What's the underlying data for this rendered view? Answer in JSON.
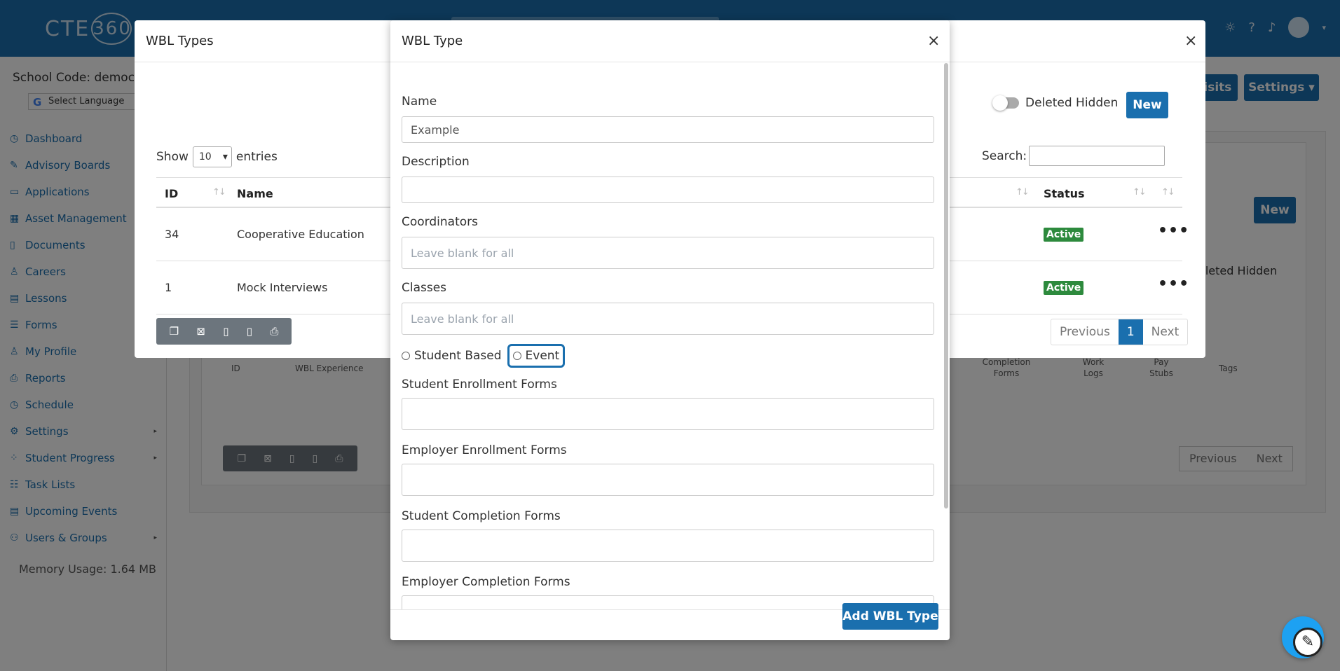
{
  "app": {
    "logo_text": "CTE",
    "logo_ring": "360",
    "school_code": "School Code: democt",
    "language_label": "Select Language",
    "memory": "Memory Usage: 1.64 MB",
    "nav": [
      {
        "label": "Dashboard",
        "icon": "dashboard-icon",
        "glyph": "◷",
        "arrow": false
      },
      {
        "label": "Advisory Boards",
        "icon": "advisory-boards-icon",
        "glyph": "✎",
        "arrow": false
      },
      {
        "label": "Applications",
        "icon": "applications-icon",
        "glyph": "▭",
        "arrow": false
      },
      {
        "label": "Asset Management",
        "icon": "asset-management-icon",
        "glyph": "▦",
        "arrow": false
      },
      {
        "label": "Documents",
        "icon": "documents-icon",
        "glyph": "▯",
        "arrow": false
      },
      {
        "label": "Careers",
        "icon": "careers-icon",
        "glyph": "♙",
        "arrow": false
      },
      {
        "label": "Lessons",
        "icon": "lessons-icon",
        "glyph": "▤",
        "arrow": false
      },
      {
        "label": "Forms",
        "icon": "forms-icon",
        "glyph": "☰",
        "arrow": false
      },
      {
        "label": "My Profile",
        "icon": "profile-icon",
        "glyph": "♙",
        "arrow": false
      },
      {
        "label": "Reports",
        "icon": "reports-icon",
        "glyph": "⎙",
        "arrow": false
      },
      {
        "label": "Schedule",
        "icon": "schedule-icon",
        "glyph": "◷",
        "arrow": false
      },
      {
        "label": "Settings",
        "icon": "settings-icon",
        "glyph": "⚙",
        "arrow": true
      },
      {
        "label": "Student Progress",
        "icon": "student-progress-icon",
        "glyph": "⁘",
        "arrow": true
      },
      {
        "label": "Task Lists",
        "icon": "task-lists-icon",
        "glyph": "☷",
        "arrow": false
      },
      {
        "label": "Upcoming Events",
        "icon": "upcoming-events-icon",
        "glyph": "▤",
        "arrow": false
      },
      {
        "label": "Users & Groups",
        "icon": "users-groups-icon",
        "glyph": "⚇",
        "arrow": true
      }
    ],
    "background": {
      "visits_btn": "Visits",
      "settings_btn": "Settings ▾",
      "new_btn": "New",
      "deleted_hidden": "eleted Hidden",
      "columns": [
        "ID",
        "WBL Experience",
        "Completion Forms",
        "Work Logs",
        "Pay Stubs",
        "Tags"
      ],
      "pager": [
        "Previous",
        "Next"
      ]
    }
  },
  "wbl_types_modal": {
    "title": "WBL Types",
    "deleted_label": "Deleted Hidden",
    "new_label": "New",
    "show_label": "Show",
    "show_value": "10",
    "entries_label": "entries",
    "search_label": "Search:",
    "columns": {
      "id": "ID",
      "name": "Name",
      "status": "Status"
    },
    "rows": [
      {
        "id": "34",
        "name": "Cooperative Education",
        "status": "Active"
      },
      {
        "id": "1",
        "name": "Mock Interviews",
        "status": "Active"
      }
    ],
    "export_icons": [
      "copy-icon",
      "excel-icon",
      "csv-icon",
      "pdf-icon",
      "print-icon"
    ],
    "pager": {
      "previous": "Previous",
      "current": "1",
      "next": "Next"
    }
  },
  "wbl_type_modal": {
    "title": "WBL Type",
    "fields": {
      "name_label": "Name",
      "name_value": "Example",
      "description_label": "Description",
      "description_value": "",
      "coordinators_label": "Coordinators",
      "coordinators_placeholder": "Leave blank for all",
      "classes_label": "Classes",
      "classes_placeholder": "Leave blank for all",
      "student_based_label": "Student Based",
      "event_label": "Event",
      "student_enrollment_label": "Student Enrollment Forms",
      "employer_enrollment_label": "Employer Enrollment Forms",
      "student_completion_label": "Student Completion Forms",
      "employer_completion_label": "Employer Completion Forms"
    },
    "submit_label": "Add WBL Type"
  },
  "colors": {
    "primary": "#1a6fae",
    "active_badge": "#2d8a3d",
    "export_bar": "#6c757d"
  }
}
